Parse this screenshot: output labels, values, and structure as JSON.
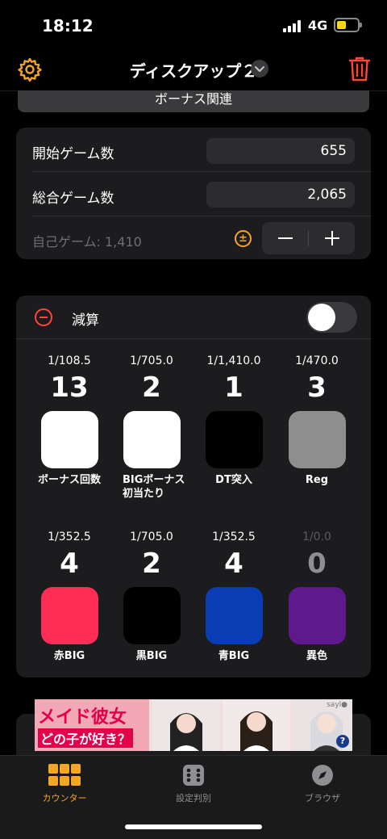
{
  "status": {
    "time": "18:12",
    "network": "4G"
  },
  "nav": {
    "title": "ディスクアップ２"
  },
  "bonus_tab": {
    "label": "ボーナス関連"
  },
  "games": {
    "start_label": "開始ゲーム数",
    "start_value": "655",
    "total_label": "総合ゲーム数",
    "total_value": "2,065",
    "self_label": "自己ゲーム: 1,410",
    "pm_glyph": "±"
  },
  "counter": {
    "subtract_label": "減算",
    "subtract_toggle_on": false,
    "tiles": [
      {
        "prob": "1/108.5",
        "count": "13",
        "label": "ボーナス回数",
        "color": "#ffffff"
      },
      {
        "prob": "1/705.0",
        "count": "2",
        "label": "BIGボーナス初当たり",
        "color": "#ffffff"
      },
      {
        "prob": "1/1,410.0",
        "count": "1",
        "label": "DT突入",
        "color": "#000000"
      },
      {
        "prob": "1/470.0",
        "count": "3",
        "label": "Reg",
        "color": "#8e8e8e"
      },
      {
        "prob": "1/352.5",
        "count": "4",
        "label": "赤BIG",
        "color": "#ff2d55"
      },
      {
        "prob": "1/705.0",
        "count": "2",
        "label": "黒BIG",
        "color": "#000000"
      },
      {
        "prob": "1/352.5",
        "count": "4",
        "label": "青BIG",
        "color": "#0a3db5"
      },
      {
        "prob": "1/0.0",
        "count": "0",
        "label": "異色",
        "color": "#5e1a8c"
      }
    ]
  },
  "ad": {
    "line1": "メイド彼女",
    "line2": "どの子が好き？",
    "brand": "sayl●"
  },
  "tabs": [
    {
      "label": "カウンター",
      "active": true
    },
    {
      "label": "設定判別",
      "active": false
    },
    {
      "label": "ブラウザ",
      "active": false
    }
  ],
  "colors": {
    "accent": "#f5a623",
    "destructive": "#ff453a",
    "inactive_tab": "#8e8e93"
  }
}
